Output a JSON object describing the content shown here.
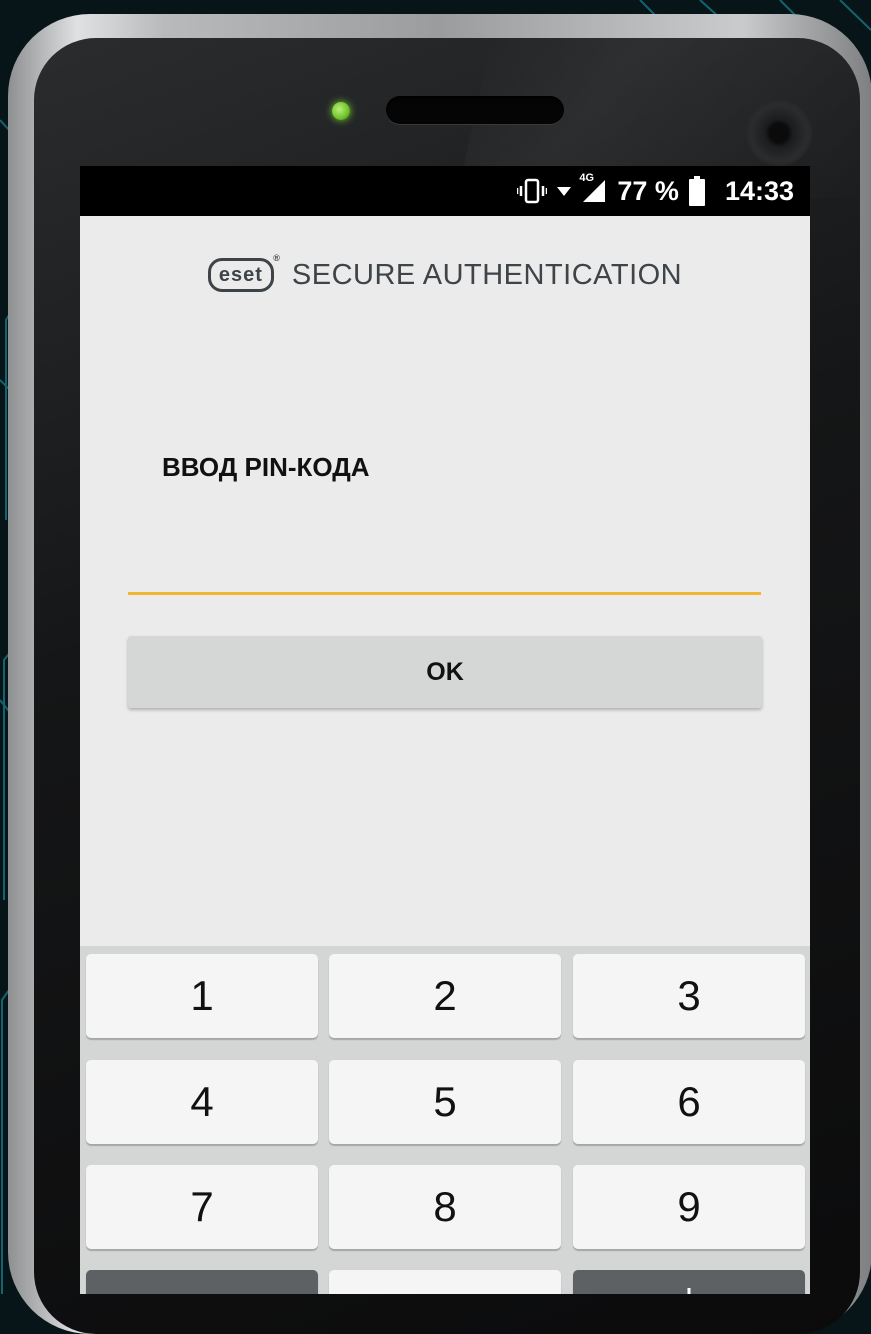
{
  "status_bar": {
    "icons": [
      "vibrate-icon",
      "wifi-icon",
      "signal-4g-icon",
      "battery-icon"
    ],
    "network_label": "4G",
    "battery_percent": "77 %",
    "time": "14:33"
  },
  "app": {
    "logo_text": "eset",
    "title": "SECURE AUTHENTICATION"
  },
  "pin_screen": {
    "title": "ВВОД PIN-КОДА",
    "input_value": "",
    "ok_label": "OK",
    "accent_color": "#f2b632"
  },
  "keypad": {
    "keys": [
      "1",
      "2",
      "3",
      "4",
      "5",
      "6",
      "7",
      "8",
      "9",
      "",
      "",
      "+"
    ]
  }
}
